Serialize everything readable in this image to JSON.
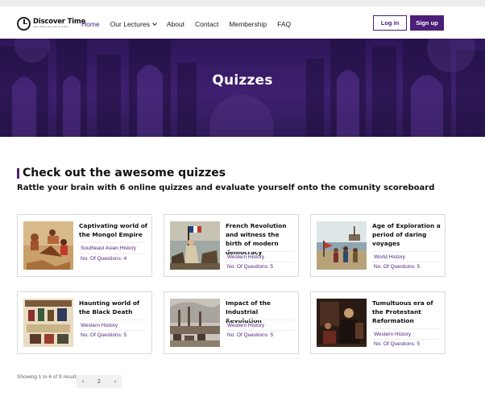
{
  "header": {
    "logo_name": "Discover Time",
    "logo_tagline": "learn history one quiz at a time",
    "nav": [
      {
        "label": "Home",
        "active": true
      },
      {
        "label": "Our Lectures",
        "has_dropdown": true
      },
      {
        "label": "About"
      },
      {
        "label": "Contact"
      },
      {
        "label": "Membership"
      },
      {
        "label": "FAQ"
      }
    ],
    "login_label": "Log in",
    "signup_label": "Sign up"
  },
  "hero": {
    "title": "Quizzes"
  },
  "section": {
    "title": "Check out the awesome quizzes",
    "subtitle": "Rattle your brain with 6 online quizzes and evaluate yourself onto the comunity scoreboard"
  },
  "quizzes": [
    {
      "title": "Captivating world of the Mongol Empire",
      "category": "Southeast Asian History",
      "questions": "No. Of Questions: 4",
      "image_icon": "mongol-battle-painting"
    },
    {
      "title": "French Revolution and witness the birth of modern democracy",
      "category": "Western History",
      "questions": "No. Of Questions: 5",
      "image_icon": "liberty-leading-people-painting"
    },
    {
      "title": "Age of Exploration a period of daring voyages",
      "category": "World History",
      "questions": "No. Of Questions: 5",
      "image_icon": "explorers-landing-painting"
    },
    {
      "title": "Haunting world of the Black Death",
      "category": "Western History",
      "questions": "No. Of Questions: 5",
      "image_icon": "black-death-illustration"
    },
    {
      "title": "Impact of the Industrial Revolution",
      "category": "Western History",
      "questions": "No. Of Questions: 5",
      "image_icon": "industrial-city-painting"
    },
    {
      "title": "Tumultuous era of the Protestant Reformation",
      "category": "Western History",
      "questions": "No. Of Questions: 5",
      "image_icon": "reformation-painting"
    }
  ],
  "pagination": {
    "showing_text": "Showing 1 to 6 of 9 results",
    "prev": "‹",
    "page": "2",
    "next": "›"
  },
  "colors": {
    "accent": "#4b1f78",
    "hero_overlay": "#3f2070"
  }
}
